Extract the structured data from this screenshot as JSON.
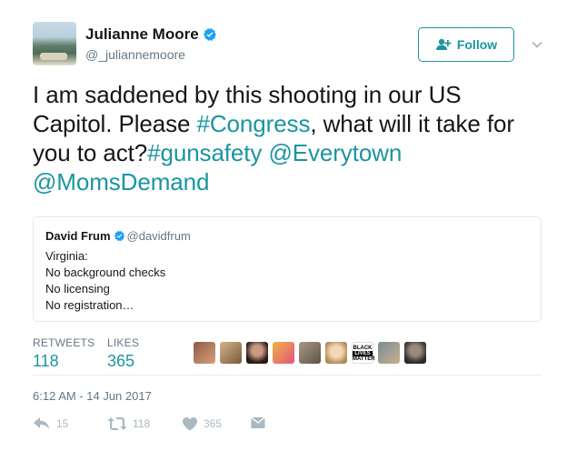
{
  "author": {
    "display_name": "Julianne Moore",
    "screen_name": "@_juliannemoore"
  },
  "follow_label": "Follow",
  "tweet": {
    "text_plain_1": "I am saddened by this shooting in our US Capitol. Please ",
    "hashtag_congress": "#Congress",
    "text_plain_2": ", what will it take for you to act?",
    "hashtag_gunsafety": "#gunsafety",
    "mention_everytown": "@Everytown",
    "mention_momsdemand": "@MomsDemand"
  },
  "quote": {
    "display_name": "David Frum",
    "screen_name": "@davidfrum",
    "lines": [
      "Virginia:",
      "No background checks",
      "No licensing",
      "No registration…"
    ]
  },
  "stats": {
    "retweets_label": "RETWEETS",
    "retweets_value": "118",
    "likes_label": "LIKES",
    "likes_value": "365"
  },
  "blm_badge": [
    "BLACK",
    "LIVES",
    "MATTER"
  ],
  "timestamp": "6:12 AM - 14 Jun 2017",
  "actions": {
    "reply_count": "15",
    "retweet_count": "118",
    "like_count": "365"
  },
  "colors": {
    "accent": "#1b95a1",
    "secondary_text": "#657786",
    "verified": "#1da1f2"
  }
}
